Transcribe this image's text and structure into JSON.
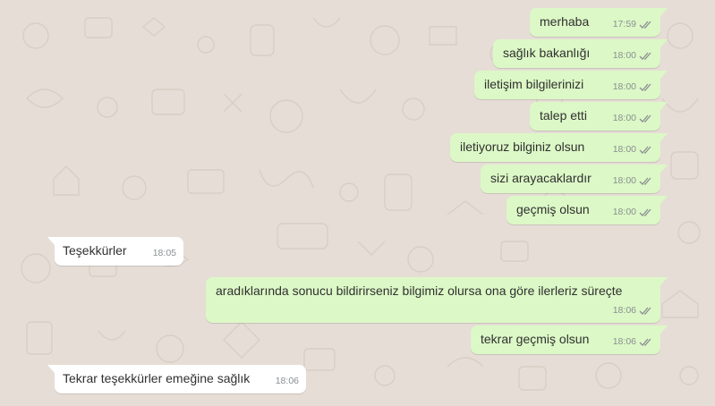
{
  "messages": [
    {
      "dir": "out",
      "text": "merhaba",
      "time": "17:59"
    },
    {
      "dir": "out",
      "text": "sağlık bakanlığı",
      "time": "18:00"
    },
    {
      "dir": "out",
      "text": "iletişim bilgilerinizi",
      "time": "18:00"
    },
    {
      "dir": "out",
      "text": "talep etti",
      "time": "18:00"
    },
    {
      "dir": "out",
      "text": "iletiyoruz bilginiz olsun",
      "time": "18:00"
    },
    {
      "dir": "out",
      "text": "sizi arayacaklardır",
      "time": "18:00"
    },
    {
      "dir": "out",
      "text": "geçmiş olsun",
      "time": "18:00"
    },
    {
      "dir": "in",
      "text": "Teşekkürler",
      "time": "18:05"
    },
    {
      "dir": "out",
      "text": "aradıklarında sonucu bildirirseniz bilgimiz olursa ona göre ilerleriz süreçte",
      "time": "18:06"
    },
    {
      "dir": "out",
      "text": "tekrar geçmiş olsun",
      "time": "18:06"
    },
    {
      "dir": "in",
      "text": "Tekrar teşekkürler emeğine sağlık",
      "time": "18:06"
    }
  ],
  "colors": {
    "background": "#e6ded6",
    "outgoing_bubble": "#dcf8c6",
    "incoming_bubble": "#ffffff",
    "read_ticks": "#8a8f92",
    "timestamp": "#8a8f92"
  },
  "icons": {
    "delivery_status": "double-check-icon",
    "background_pattern": "doodle-wallpaper"
  }
}
